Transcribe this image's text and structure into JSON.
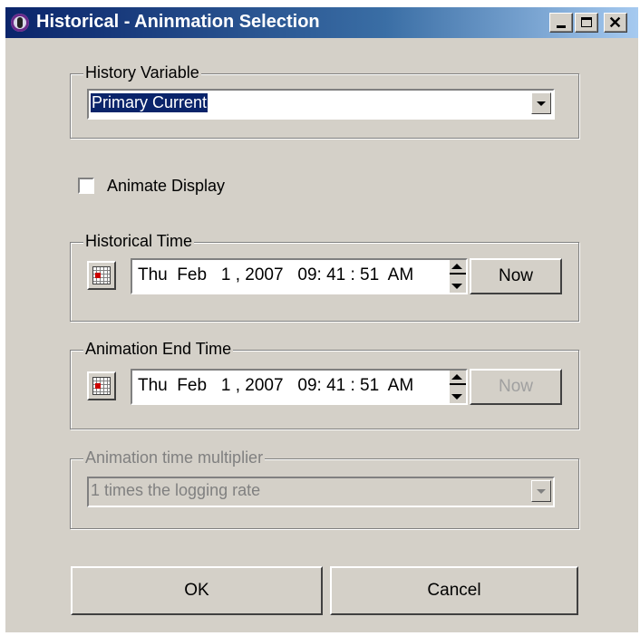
{
  "window": {
    "title": "Historical - Aninmation Selection"
  },
  "history_variable": {
    "legend": "History Variable",
    "value": "Primary Current"
  },
  "animate": {
    "label": "Animate Display",
    "checked": false
  },
  "historical_time": {
    "legend": "Historical Time",
    "value": "Thu  Feb   1 , 2007   09: 41 : 51  AM",
    "now_label": "Now"
  },
  "animation_end_time": {
    "legend": "Animation End Time",
    "value": "Thu  Feb   1 , 2007   09: 41 : 51  AM",
    "now_label": "Now"
  },
  "multiplier": {
    "legend": "Animation time multiplier",
    "value": "1 times the logging rate"
  },
  "buttons": {
    "ok": "OK",
    "cancel": "Cancel"
  }
}
